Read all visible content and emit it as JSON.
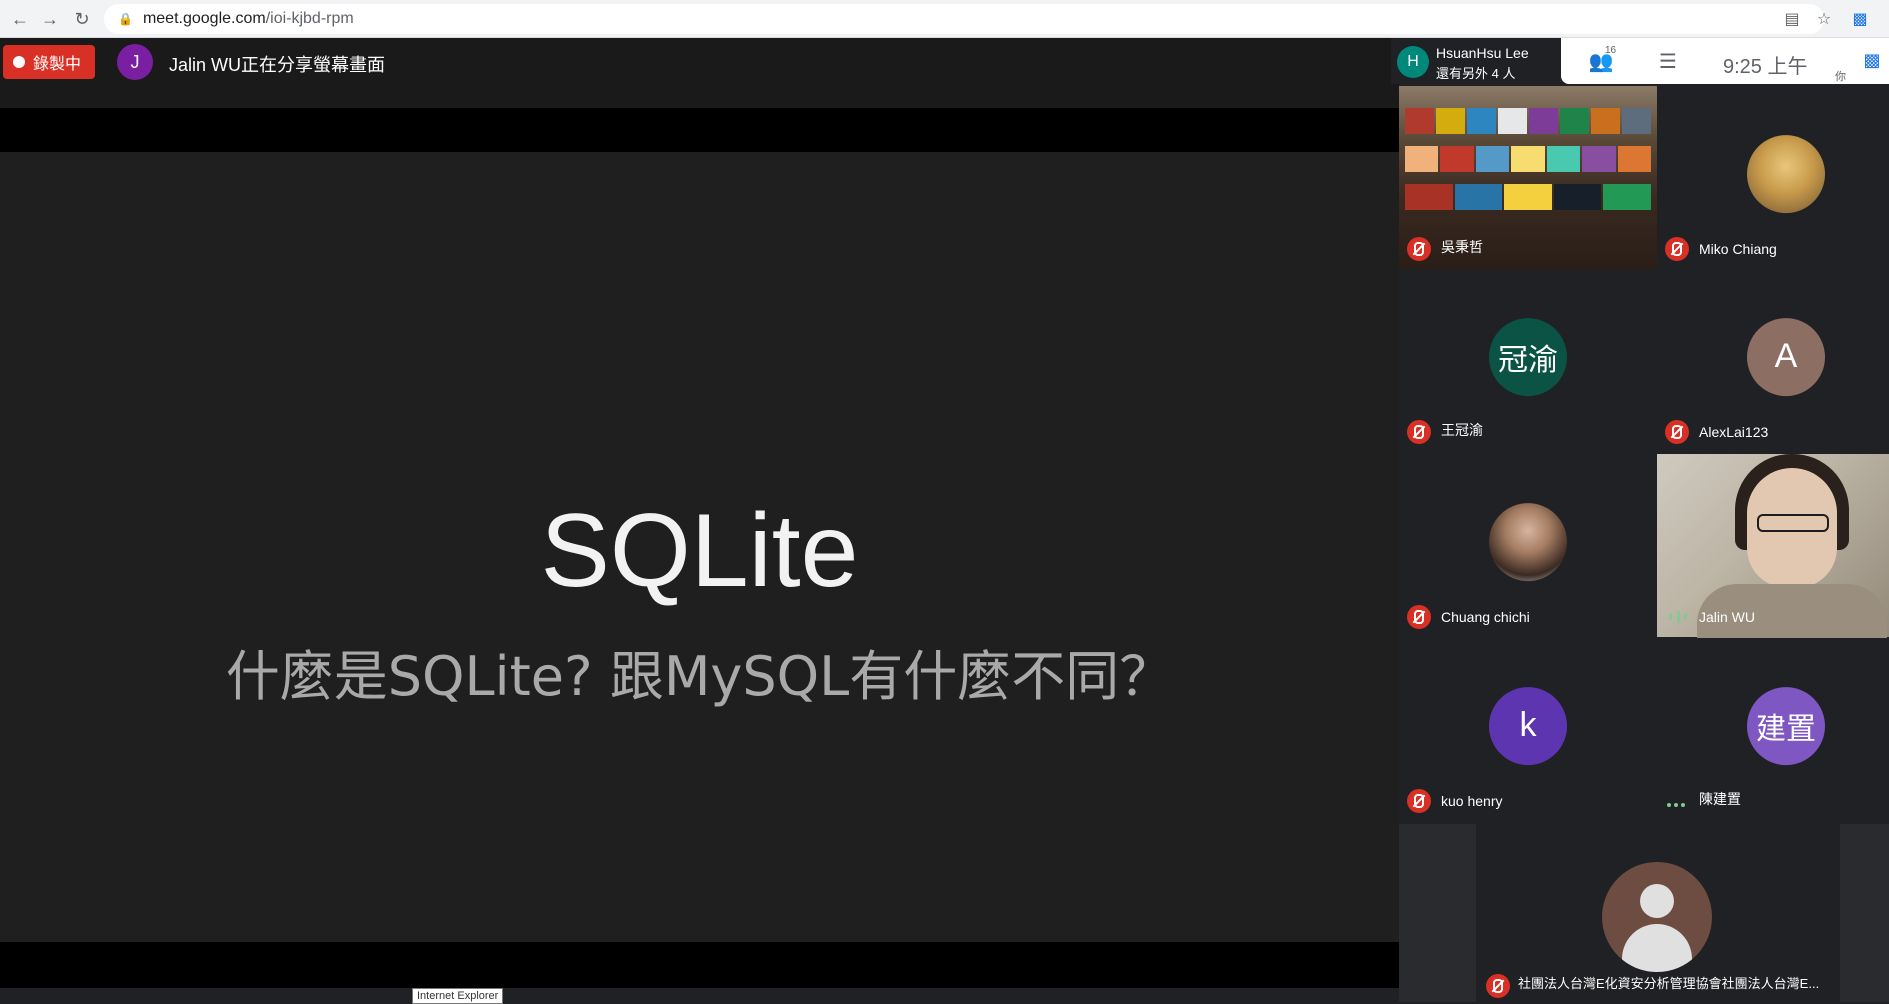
{
  "browser": {
    "url_host": "meet.google.com",
    "url_path": "/ioi-kjbd-rpm"
  },
  "meet": {
    "recording_label": "錄製中",
    "presenter_initial": "J",
    "presenter_text": "Jalin WU正在分享螢幕畫面",
    "host_initial": "H",
    "host_name": "HsuanHsu Lee",
    "host_others": "還有另外 4 人",
    "participant_count": "16",
    "clock": "9:25 上午",
    "you_label": "你",
    "slide_title": "SQLite",
    "slide_subtitle": "什麼是SQLite? 跟MySQL有什麼不同？",
    "tooltip": "Internet Explorer",
    "colors": {
      "record_red": "#d93025",
      "presenter_purple": "#7b1fa2",
      "host_teal": "#00897b"
    }
  },
  "tiles": [
    {
      "name": "吳秉哲",
      "kind": "video-bookshelf",
      "status": "muted"
    },
    {
      "name": "Miko Chiang",
      "kind": "photo-dog",
      "status": "muted"
    },
    {
      "name": "王冠渝",
      "initial": "冠渝",
      "color": "#0b5345",
      "status": "muted"
    },
    {
      "name": "AlexLai123",
      "initial": "A",
      "color": "#8d6e63",
      "status": "muted"
    },
    {
      "name": "Chuang chichi",
      "kind": "photo-person",
      "status": "muted"
    },
    {
      "name": "Jalin WU",
      "kind": "video-girl",
      "status": "speaking"
    },
    {
      "name": "kuo henry",
      "initial": "k",
      "color": "#5e35b1",
      "status": "muted"
    },
    {
      "name": "陳建置",
      "initial": "建置",
      "color": "#7e57c2",
      "status": "dots"
    }
  ],
  "bottom_tile": {
    "name": "社團法人台灣E化資安分析管理協會社團法人台灣E...",
    "status": "muted"
  }
}
